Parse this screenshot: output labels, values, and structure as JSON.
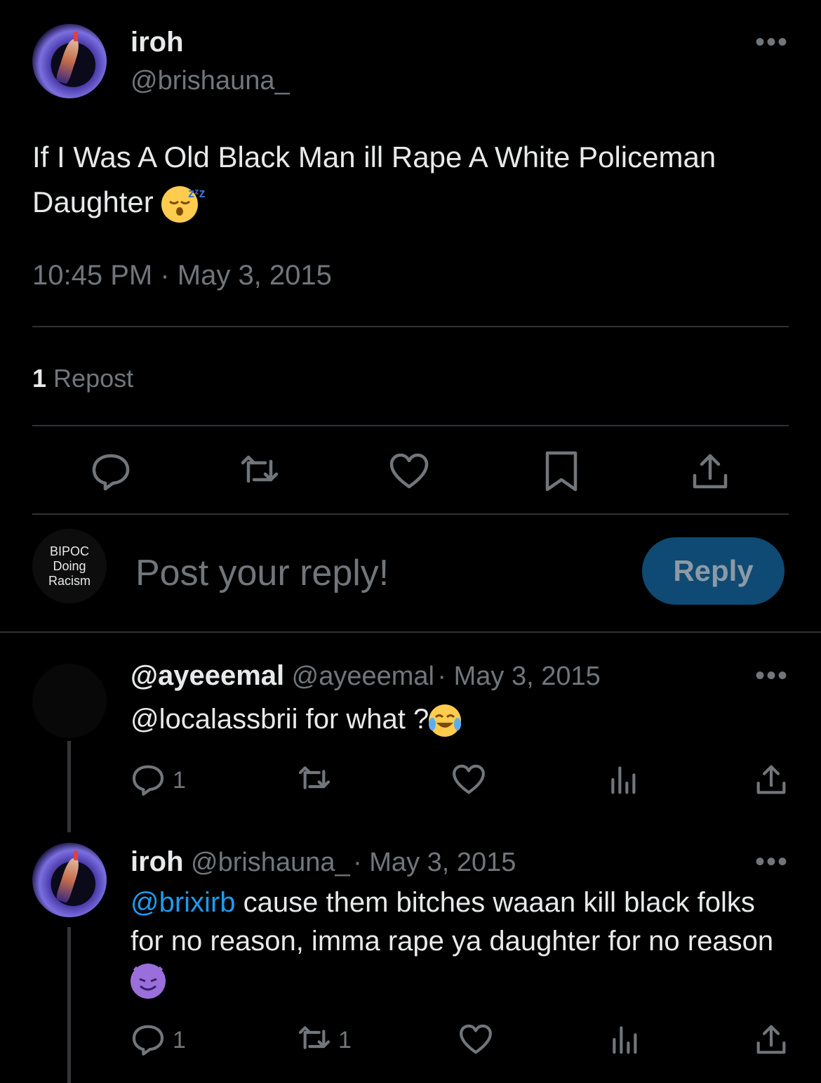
{
  "tweet": {
    "author_name": "iroh",
    "author_handle": "@brishauna_",
    "text": "If I Was A Old Black Man ill Rape A White Policeman Daughter",
    "timestamp": "10:45 PM · May 3, 2015",
    "repost_count": "1",
    "repost_label": "Repost",
    "more_label": "•••"
  },
  "composer": {
    "avatar_line1": "BIPOC",
    "avatar_line2": "Doing",
    "avatar_line3": "Racism",
    "placeholder": "Post your reply!",
    "reply_button": "Reply"
  },
  "replies": [
    {
      "name": "@ayeeemal",
      "handle": "@ayeeemal",
      "date": "· May 3, 2015",
      "text_mention": "@localassbrii",
      "text": "for what ?",
      "reply_count": "1",
      "repost_count": "",
      "more_label": "•••"
    },
    {
      "name": "iroh",
      "handle": "@brishauna_",
      "date": "· May 3, 2015",
      "text_mention": "@brixirb",
      "text": " cause them bitches waaan kill black folks for no reason, imma rape ya daughter for no reason",
      "reply_count": "1",
      "repost_count": "1",
      "more_label": "•••"
    }
  ],
  "icons": {
    "main_actions": [
      "reply-icon",
      "repost-icon",
      "like-icon",
      "bookmark-icon",
      "share-icon"
    ],
    "reply_actions": [
      "reply-icon",
      "repost-icon",
      "like-icon",
      "views-icon",
      "share-icon"
    ]
  },
  "colors": {
    "background": "#000000",
    "text": "#e7e9ea",
    "muted": "#71767b",
    "accent": "#1d9bf0",
    "reply_button_bg": "#0e4a73"
  }
}
